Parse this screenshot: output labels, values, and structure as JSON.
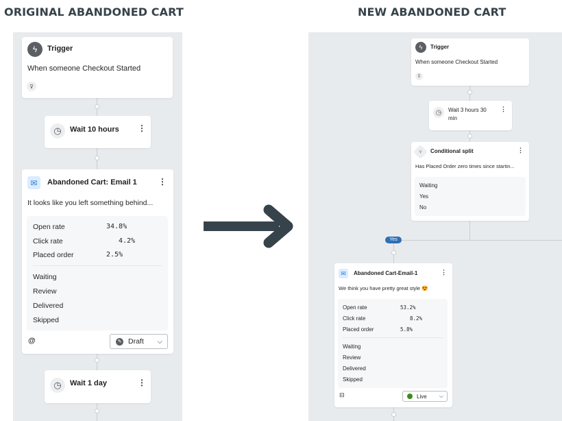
{
  "headings": {
    "left": "ORIGINAL ABANDONED CART",
    "right": "NEW ABANDONED CART"
  },
  "arrow": {
    "icon": "arrow-right-icon",
    "color": "#37434b"
  },
  "original": {
    "trigger": {
      "title": "Trigger",
      "description": "When someone Checkout Started",
      "icon": "lightning-icon",
      "filter_icon": "filter-icon"
    },
    "wait1": {
      "label": "Wait 10 hours",
      "icon": "clock-icon"
    },
    "email": {
      "title": "Abandoned Cart: Email 1",
      "preview": "It looks like you left something behind...",
      "stats": [
        {
          "label": "Open rate",
          "value": "34.8%"
        },
        {
          "label": "Click rate",
          "value": "4.2%"
        },
        {
          "label": "Placed order",
          "value": "2.5%"
        }
      ],
      "statuses": [
        "Waiting",
        "Review",
        "Delivered",
        "Skipped"
      ],
      "status_select": {
        "value": "Draft",
        "icon": "draft-icon"
      }
    },
    "wait2": {
      "label": "Wait 1 day",
      "icon": "clock-icon"
    }
  },
  "new": {
    "trigger": {
      "title": "Trigger",
      "description": "When someone Checkout Started",
      "icon": "lightning-icon",
      "filter_icon": "filter-icon"
    },
    "wait1": {
      "label": "Wait 3 hours 30 min",
      "icon": "clock-icon"
    },
    "split": {
      "title": "Conditional split",
      "description": "Has Placed Order zero times since startin...",
      "statuses": [
        "Waiting",
        "Yes",
        "No"
      ]
    },
    "branch_label": "Yes",
    "email": {
      "title": "Abandoned Cart-Email-1",
      "preview": "We think you have pretty great style 😍",
      "stats": [
        {
          "label": "Open rate",
          "value": "53.2%"
        },
        {
          "label": "Click rate",
          "value": "8.2%"
        },
        {
          "label": "Placed order",
          "value": "5.8%"
        }
      ],
      "statuses": [
        "Waiting",
        "Review",
        "Delivered",
        "Skipped"
      ],
      "status_select": {
        "value": "Live",
        "icon": "live-icon",
        "color": "#3c8b1e"
      }
    }
  }
}
